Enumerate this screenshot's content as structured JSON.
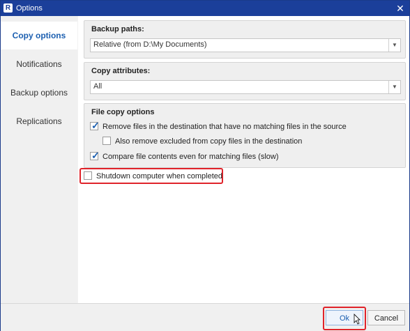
{
  "window": {
    "title": "Options",
    "icon": "R",
    "close_glyph": "✕"
  },
  "sidebar": {
    "items": [
      {
        "label": "Copy options",
        "active": true
      },
      {
        "label": "Notifications",
        "active": false
      },
      {
        "label": "Backup options",
        "active": false
      },
      {
        "label": "Replications",
        "active": false
      }
    ]
  },
  "backup_paths": {
    "title": "Backup paths:",
    "selected": "Relative (from D:\\My Documents)"
  },
  "copy_attributes": {
    "title": "Copy attributes:",
    "selected": "All"
  },
  "file_copy_options": {
    "title": "File copy options",
    "remove_unmatched": {
      "label": "Remove files in the destination that have no matching files in the source",
      "checked": true
    },
    "remove_excluded": {
      "label": "Also remove excluded from copy files in the destination",
      "checked": false
    },
    "compare_contents": {
      "label": "Compare file contents even for matching files (slow)",
      "checked": true
    }
  },
  "shutdown": {
    "label": "Shutdown computer when completed",
    "checked": false
  },
  "footer": {
    "ok_label": "Ok",
    "cancel_label": "Cancel"
  },
  "colors": {
    "titlebar": "#1b3f9a",
    "accent": "#1c5fb0",
    "highlight": "#e0232a"
  },
  "icons": {
    "dropdown": "chevron-down-icon",
    "check": "check-icon"
  }
}
